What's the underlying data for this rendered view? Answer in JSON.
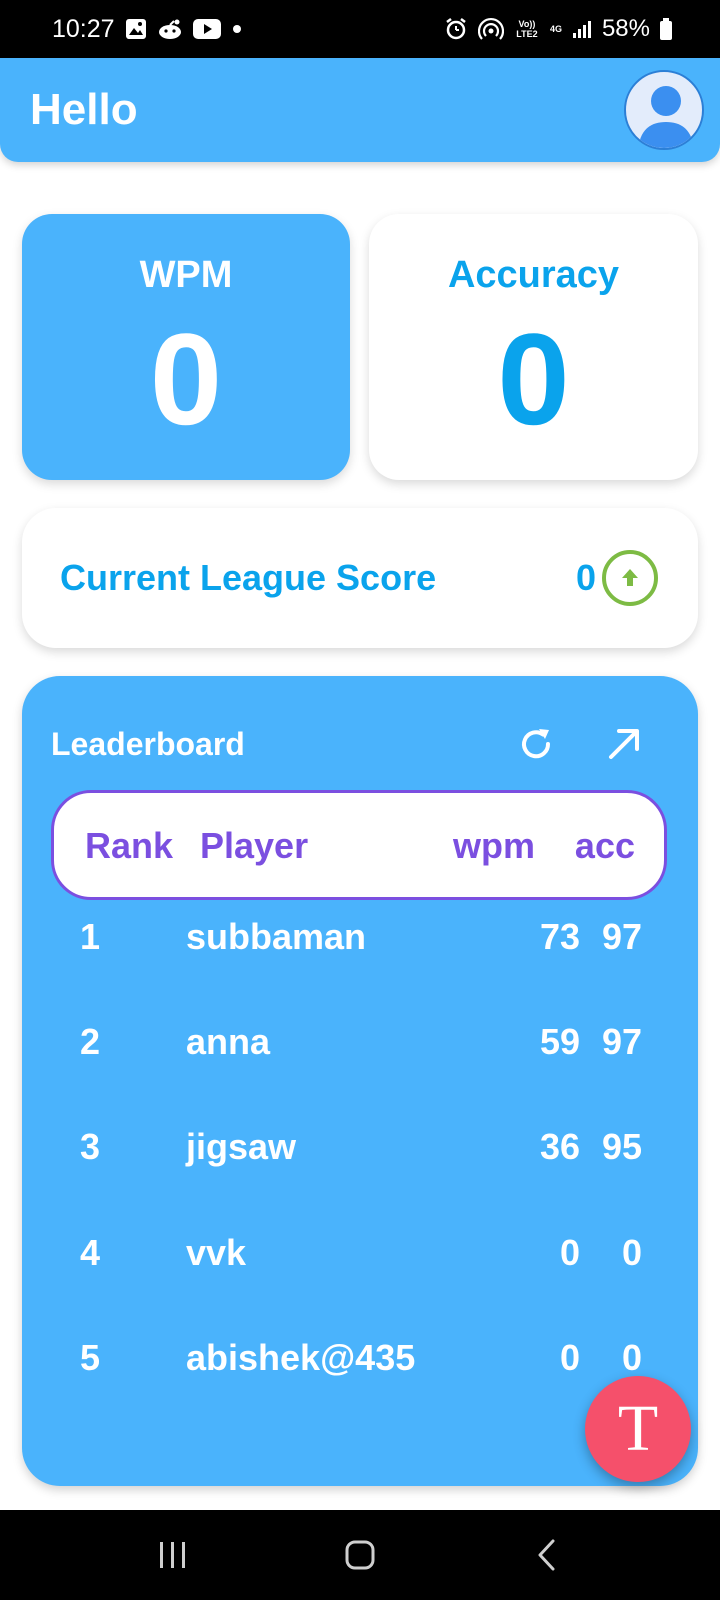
{
  "status_bar": {
    "time": "10:27",
    "left_icons": [
      "gallery-icon",
      "reddit-icon",
      "youtube-icon",
      "dot-icon"
    ],
    "right_icons": [
      "alarm-icon",
      "hotspot-icon",
      "volte-icon",
      "4g-icon",
      "signal-icon",
      "battery-icon"
    ],
    "volte_label": "Vo)) LTE2",
    "network_label": "4G",
    "battery": "58%"
  },
  "header": {
    "greeting": "Hello",
    "avatar_icon": "user-avatar-icon"
  },
  "stats": {
    "wpm_label": "WPM",
    "wpm_value": "0",
    "accuracy_label": "Accuracy",
    "accuracy_value": "0"
  },
  "league": {
    "label": "Current League Score",
    "value": "0",
    "trend_icon": "arrow-up-circle-icon"
  },
  "leaderboard": {
    "title": "Leaderboard",
    "refresh_icon": "refresh-icon",
    "expand_icon": "arrow-up-right-icon",
    "columns": {
      "rank": "Rank",
      "player": "Player",
      "wpm": "wpm",
      "acc": "acc"
    },
    "rows": [
      {
        "rank": "1",
        "player": "subbaman",
        "wpm": "73",
        "acc": "97"
      },
      {
        "rank": "2",
        "player": "anna",
        "wpm": "59",
        "acc": "97"
      },
      {
        "rank": "3",
        "player": "jigsaw",
        "wpm": "36",
        "acc": "95"
      },
      {
        "rank": "4",
        "player": "vvk",
        "wpm": "0",
        "acc": "0"
      },
      {
        "rank": "5",
        "player": "abishek@435",
        "wpm": "0",
        "acc": "0"
      }
    ]
  },
  "fab": {
    "label": "T"
  },
  "colors": {
    "primary": "#4ab3fc",
    "accent_text": "#0aa3ec",
    "header_purple": "#7b4fe0",
    "fab": "#f5506b",
    "trend_green": "#7dbb44"
  }
}
